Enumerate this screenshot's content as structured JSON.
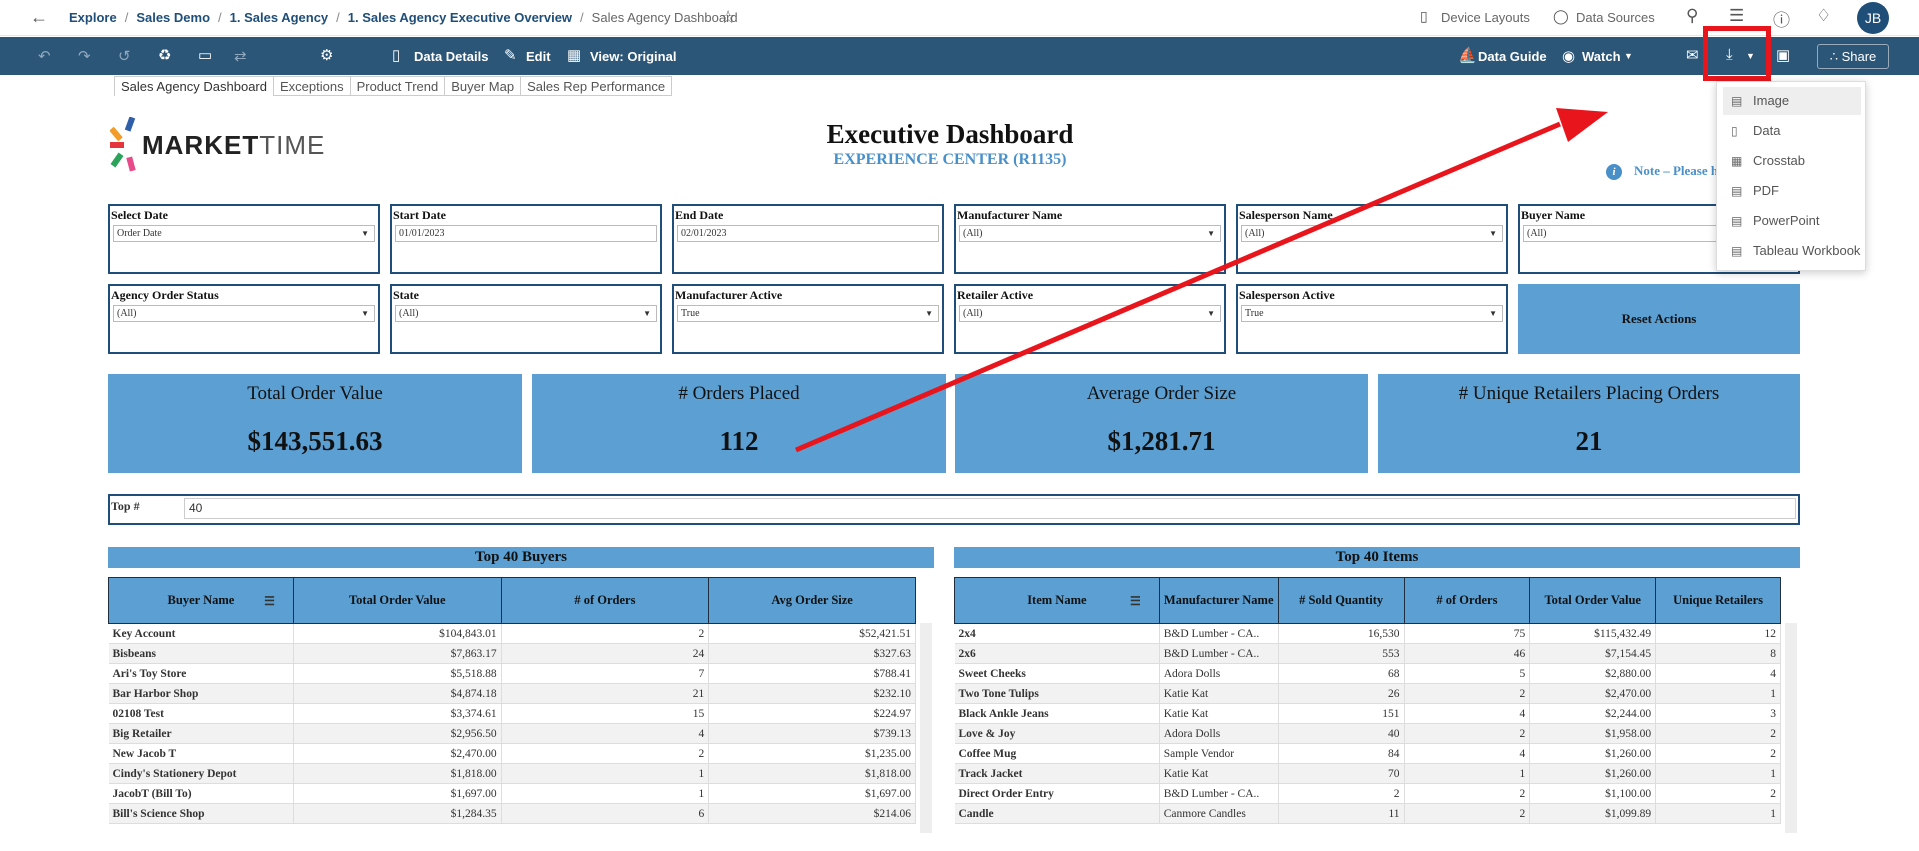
{
  "breadcrumb": [
    "Explore",
    "Sales Demo",
    "1. Sales Agency",
    "1. Sales Agency Executive Overview",
    "Sales Agency Dashboard"
  ],
  "top_right": {
    "device_layouts": "Device Layouts",
    "data_sources": "Data Sources",
    "avatar": "JB"
  },
  "toolbar": {
    "data_details": "Data Details",
    "edit": "Edit",
    "view": "View: Original",
    "data_guide": "Data Guide",
    "watch": "Watch",
    "share": "Share"
  },
  "tabs": [
    "Sales Agency Dashboard",
    "Exceptions",
    "Product Trend",
    "Buyer Map",
    "Sales Rep Performance"
  ],
  "logo": {
    "bold": "MARKET",
    "light": "TIME"
  },
  "dashboard": {
    "title": "Executive Dashboard",
    "subtitle": "EXPERIENCE CENTER (R1135)",
    "note": "Note – Please h",
    "info_glyph": "i"
  },
  "filters": [
    {
      "label": "Select Date",
      "value": "Order Date",
      "dropdown": true
    },
    {
      "label": "Start Date",
      "value": "01/01/2023",
      "dropdown": false
    },
    {
      "label": "End Date",
      "value": "02/01/2023",
      "dropdown": false
    },
    {
      "label": "Manufacturer Name",
      "value": "(All)",
      "dropdown": true
    },
    {
      "label": "Salesperson Name",
      "value": "(All)",
      "dropdown": true
    },
    {
      "label": "Buyer Name",
      "value": "(All)",
      "dropdown": true
    },
    {
      "label": "Agency Order Status",
      "value": "(All)",
      "dropdown": true
    },
    {
      "label": "State",
      "value": "(All)",
      "dropdown": true
    },
    {
      "label": "Manufacturer Active",
      "value": "True",
      "dropdown": true
    },
    {
      "label": "Retailer Active",
      "value": "(All)",
      "dropdown": true
    },
    {
      "label": "Salesperson Active",
      "value": "True",
      "dropdown": true
    }
  ],
  "reset_label": "Reset Actions",
  "kpis": [
    {
      "label": "Total Order Value",
      "value": "$143,551.63"
    },
    {
      "label": "# Orders Placed",
      "value": "112"
    },
    {
      "label": "Average Order Size",
      "value": "$1,281.71"
    },
    {
      "label": "# Unique Retailers Placing Orders",
      "value": "21"
    }
  ],
  "top_n": {
    "label": "Top #",
    "value": "40"
  },
  "buyers_table": {
    "title": "Top 40 Buyers",
    "headers": [
      "Buyer Name",
      "Total Order Value",
      "# of Orders",
      "Avg Order Size"
    ],
    "rows": [
      [
        "Key Account",
        "$104,843.01",
        "2",
        "$52,421.51"
      ],
      [
        "Bisbeans",
        "$7,863.17",
        "24",
        "$327.63"
      ],
      [
        "Ari's Toy Store",
        "$5,518.88",
        "7",
        "$788.41"
      ],
      [
        "Bar Harbor Shop",
        "$4,874.18",
        "21",
        "$232.10"
      ],
      [
        "02108 Test",
        "$3,374.61",
        "15",
        "$224.97"
      ],
      [
        "Big Retailer",
        "$2,956.50",
        "4",
        "$739.13"
      ],
      [
        "New Jacob T",
        "$2,470.00",
        "2",
        "$1,235.00"
      ],
      [
        "Cindy's Stationery Depot",
        "$1,818.00",
        "1",
        "$1,818.00"
      ],
      [
        "JacobT (Bill To)",
        "$1,697.00",
        "1",
        "$1,697.00"
      ],
      [
        "Bill's Science Shop",
        "$1,284.35",
        "6",
        "$214.06"
      ]
    ]
  },
  "items_table": {
    "title": "Top 40 Items",
    "headers": [
      "Item Name",
      "Manufacturer Name",
      "# Sold Quantity",
      "# of Orders",
      "Total Order Value",
      "Unique Retailers"
    ],
    "rows": [
      [
        "2x4",
        "B&D Lumber - CA..",
        "16,530",
        "75",
        "$115,432.49",
        "12"
      ],
      [
        "2x6",
        "B&D Lumber - CA..",
        "553",
        "46",
        "$7,154.45",
        "8"
      ],
      [
        "Sweet Cheeks",
        "Adora Dolls",
        "68",
        "5",
        "$2,880.00",
        "4"
      ],
      [
        "Two Tone Tulips",
        "Katie Kat",
        "26",
        "2",
        "$2,470.00",
        "1"
      ],
      [
        "Black Ankle Jeans",
        "Katie Kat",
        "151",
        "4",
        "$2,244.00",
        "3"
      ],
      [
        "Love & Joy",
        "Adora Dolls",
        "40",
        "2",
        "$1,958.00",
        "2"
      ],
      [
        "Coffee Mug",
        "Sample Vendor",
        "84",
        "4",
        "$1,260.00",
        "2"
      ],
      [
        "Track Jacket",
        "Katie Kat",
        "70",
        "1",
        "$1,260.00",
        "1"
      ],
      [
        "Direct Order Entry",
        "B&D Lumber - CA..",
        "2",
        "2",
        "$1,100.00",
        "2"
      ],
      [
        "Candle",
        "Canmore Candles",
        "11",
        "2",
        "$1,099.89",
        "1"
      ]
    ]
  },
  "download_menu": [
    "Image",
    "Data",
    "Crosstab",
    "PDF",
    "PowerPoint",
    "Tableau Workbook"
  ],
  "colors": {
    "accent": "#5b9fd3",
    "toolbar": "#2c5677",
    "annotation": "#e8151c"
  }
}
